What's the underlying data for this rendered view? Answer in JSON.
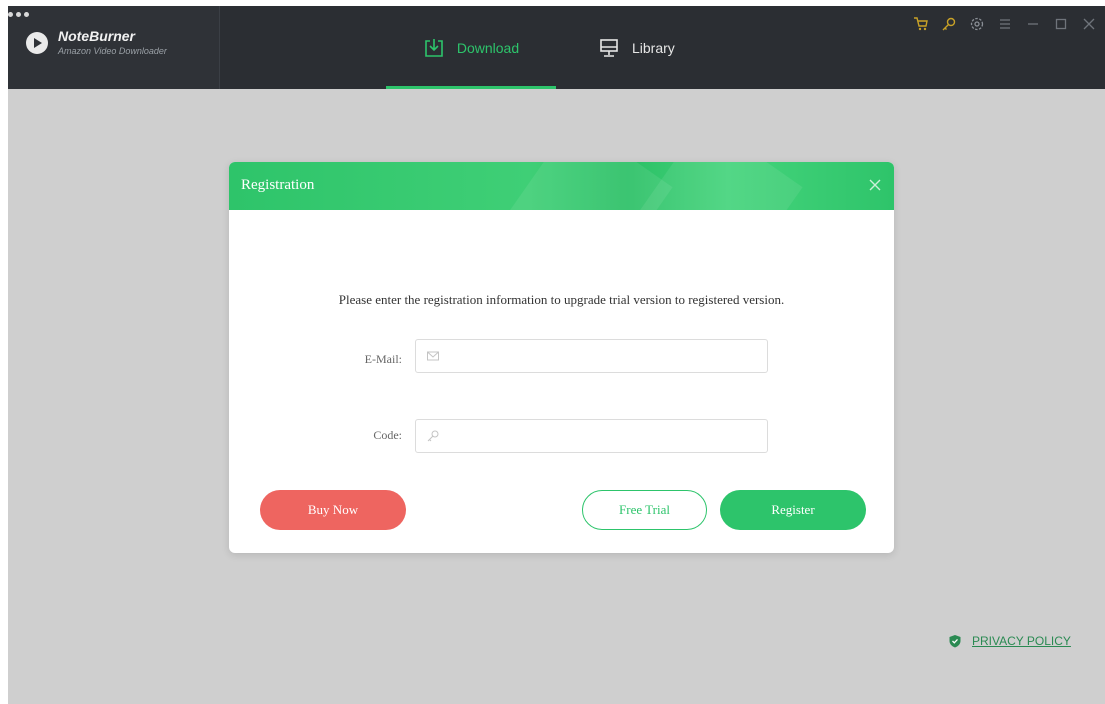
{
  "app": {
    "name": "NoteBurner",
    "subtitle": "Amazon Video Downloader",
    "accent_color": "#2dc46b"
  },
  "tabs": [
    {
      "label": "Download",
      "icon": "download-icon",
      "active": true
    },
    {
      "label": "Library",
      "icon": "monitor-icon",
      "active": false
    }
  ],
  "window_controls": [
    "cart-icon",
    "key-icon",
    "gear-icon",
    "menu-icon",
    "minimize-icon",
    "maximize-icon",
    "close-icon"
  ],
  "dialog": {
    "title": "Registration",
    "instructions": "Please enter the registration information to upgrade trial version to registered version.",
    "email": {
      "label": "E-Mail:",
      "value": "",
      "placeholder": "",
      "icon": "mail-icon"
    },
    "code": {
      "label": "Code:",
      "value": "",
      "placeholder": "",
      "icon": "key-icon"
    },
    "buttons": {
      "buy": "Buy Now",
      "trial": "Free Trial",
      "register": "Register"
    },
    "colors": {
      "buy": "#ee6560",
      "register": "#2dc46b"
    }
  },
  "footer": {
    "privacy": "PRIVACY POLICY",
    "icon": "shield-icon"
  }
}
